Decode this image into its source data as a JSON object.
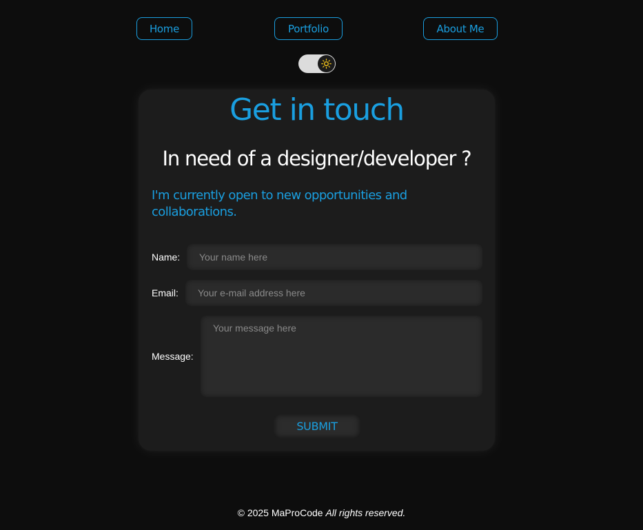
{
  "nav": {
    "home": "Home",
    "portfolio": "Portfolio",
    "about": "About Me"
  },
  "theme_toggle": {
    "icon": "sun-icon",
    "state": "light-off",
    "accent": "#f5c518"
  },
  "contact": {
    "title": "Get in touch",
    "subtitle": "In need of a designer/developer ?",
    "intro": "I'm currently open to new opportunities and collaborations.",
    "name_label": "Name:",
    "name_placeholder": "Your name here",
    "email_label": "Email:",
    "email_placeholder": "Your e-mail address here",
    "message_label": "Message:",
    "message_placeholder": "Your message here",
    "submit_label": "SUBMIT"
  },
  "footer": {
    "copyright": "© 2025 MaProCode",
    "rights": "All rights reserved."
  },
  "colors": {
    "accent": "#1a9fe0",
    "background": "#0d0d0d",
    "card": "#1c1c1c"
  }
}
